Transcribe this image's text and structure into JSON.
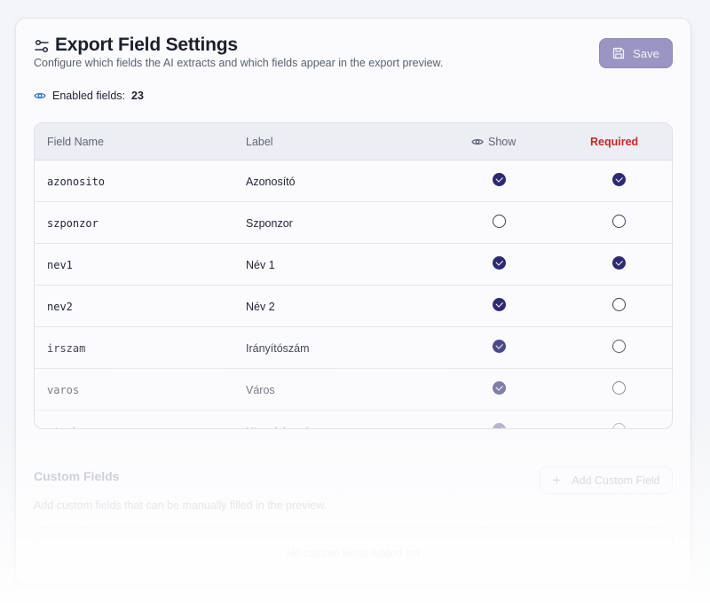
{
  "header": {
    "title": "Export Field Settings",
    "subtitle": "Configure which fields the AI extracts and which fields appear in the export preview.",
    "icon": "sliders-icon",
    "save_label": "Save"
  },
  "enabled": {
    "label": "Enabled fields:",
    "count": "23"
  },
  "table": {
    "columns": {
      "name": "Field Name",
      "label": "Label",
      "show": "Show",
      "required": "Required"
    },
    "rows": [
      {
        "name": "azonosito",
        "label": "Azonosító",
        "show": true,
        "required": true
      },
      {
        "name": "szponzor",
        "label": "Szponzor",
        "show": false,
        "required": false
      },
      {
        "name": "nev1",
        "label": "Név 1",
        "show": true,
        "required": true
      },
      {
        "name": "nev2",
        "label": "Név 2",
        "show": true,
        "required": false
      },
      {
        "name": "irszam",
        "label": "Irányítószám",
        "show": true,
        "required": false
      },
      {
        "name": "varos",
        "label": "Város",
        "show": true,
        "required": false
      },
      {
        "name": "utcahaz",
        "label": "Utca, házszám",
        "show": true,
        "required": false
      }
    ]
  },
  "custom": {
    "title": "Custom Fields",
    "description": "Add custom fields that can be manually filled in the preview.",
    "add_label": "Add Custom Field",
    "empty_text": "No custom fields added yet"
  },
  "colors": {
    "accent": "#2d2a72",
    "save_button": "#9a95c2",
    "required": "#c62828"
  }
}
